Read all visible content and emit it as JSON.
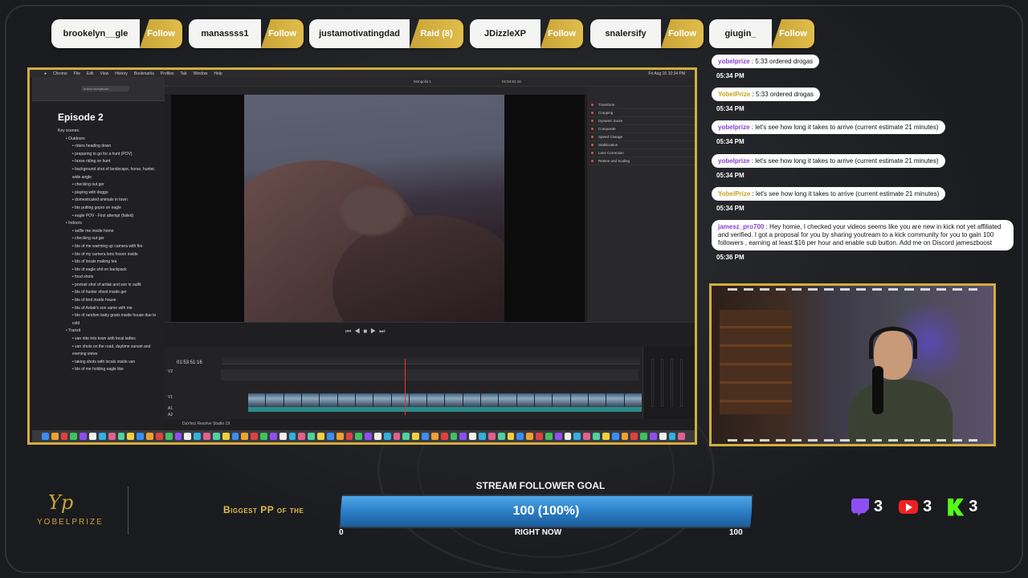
{
  "followers": [
    {
      "name": "brookelyn__gle",
      "action": "Follow"
    },
    {
      "name": "manassss1",
      "action": "Follow"
    },
    {
      "name": "justamotivatingdad",
      "action": "Raid (8)"
    },
    {
      "name": "JDizzleXP",
      "action": "Follow"
    },
    {
      "name": "snalersify",
      "action": "Follow"
    },
    {
      "name": "giugin_",
      "action": "Follow"
    }
  ],
  "editor": {
    "doc_title": "Episode 2",
    "doc_items": [
      {
        "t": "Key scenes:",
        "lvl": 0
      },
      {
        "t": "Outdoors",
        "lvl": 1
      },
      {
        "t": "riders heading down",
        "lvl": 2
      },
      {
        "t": "preparing to go for a hunt (POV)",
        "lvl": 2
      },
      {
        "t": "horse riding on hunt",
        "lvl": 2
      },
      {
        "t": "background shot of landscape, horse, hunter, wide angle",
        "lvl": 2
      },
      {
        "t": "checking out ger",
        "lvl": 2
      },
      {
        "t": "playing with doggo",
        "lvl": 2
      },
      {
        "t": "domesticated animals in town",
        "lvl": 2
      },
      {
        "t": "bts putting gopro on eagle",
        "lvl": 2
      },
      {
        "t": "eagle POV - First attempt (failed)",
        "lvl": 2
      },
      {
        "t": "Indoors",
        "lvl": 1
      },
      {
        "t": "selfie me inside home",
        "lvl": 2
      },
      {
        "t": "checking out ger",
        "lvl": 2
      },
      {
        "t": "bts of me warming up camera with fire",
        "lvl": 2
      },
      {
        "t": "bts of my camera lens frozen inside",
        "lvl": 2
      },
      {
        "t": "bts of locals making tea",
        "lvl": 2
      },
      {
        "t": "bts of eagle shit on backpack",
        "lvl": 2
      },
      {
        "t": "food shots",
        "lvl": 2
      },
      {
        "t": "portrait shot of ardak and son in outfit",
        "lvl": 2
      },
      {
        "t": "bts of hunter shoot inside ger",
        "lvl": 2
      },
      {
        "t": "bts of bird inside house",
        "lvl": 2
      },
      {
        "t": "bts of Ardak's son same with me",
        "lvl": 2
      },
      {
        "t": "bts of random baby goats inside house due to cold",
        "lvl": 2
      },
      {
        "t": "Transit",
        "lvl": 1
      },
      {
        "t": "van ride into town with local ladies",
        "lvl": 2
      },
      {
        "t": "van shots on the road, daytime sunset and evening views",
        "lvl": 2
      },
      {
        "t": "taking shots with locals inside van",
        "lvl": 2
      },
      {
        "t": "bts of me holding eagle like",
        "lvl": 2
      }
    ],
    "url": "notion.so/episode",
    "project": "Mongolia 1",
    "timecode": "01:53:51:16",
    "viewer_tc": "01:53:51:16",
    "app_name": "DaVinci Resolve Studio 19",
    "inspector_rows": [
      "Transform",
      "Cropping",
      "Dynamic Zoom",
      "Composite",
      "Speed Change",
      "Stabilization",
      "Lens Correction",
      "Retime and Scaling"
    ],
    "track_labels": [
      "V2",
      "V1",
      "A1",
      "A2"
    ],
    "menu": [
      "Chrome",
      "File",
      "Edit",
      "View",
      "History",
      "Bookmarks",
      "Profiles",
      "Tab",
      "Window",
      "Help"
    ],
    "date": "Fri Aug 16 10:34 PM",
    "accent_color": "#d3ad3e"
  },
  "chat": [
    {
      "user": "yobelprize",
      "text": "5:33 ordered drogas",
      "time": "05:34 PM",
      "user_color": "purple"
    },
    {
      "user": "YobelPrize",
      "text": "5:33 ordered drogas",
      "time": "05:34 PM",
      "user_color": "gold"
    },
    {
      "user": "yobelprize",
      "text": "let's see how long it takes to arrive (current estimate 21 minutes)",
      "time": "05:34 PM",
      "user_color": "purple"
    },
    {
      "user": "yobelprize",
      "text": "let's see how long it takes to arrive (current estimate 21 minutes)",
      "time": "05:34 PM",
      "user_color": "purple"
    },
    {
      "user": "YobelPrize",
      "text": "let's see how long it takes to arrive (current estimate 21 minutes)",
      "time": "05:34 PM",
      "user_color": "gold"
    },
    {
      "user": "jamesz_pro700",
      "text": "Hey homie, I checked your videos seems like you are new in kick not yet affiliated and verified. I got a proposal for you by sharing youtream to a kick community for you to gain 100 followers , earning at least $16 per hour and enable sub button. Add me on Discord jameszboost",
      "time": "05:36 PM",
      "user_color": "purple"
    }
  ],
  "brand": {
    "name": "YOBELPRIZE",
    "mark": "Yp"
  },
  "ticker": "Biggest PP of the",
  "goal": {
    "title": "STREAM FOLLOWER GOAL",
    "value_text": "100 (100%)",
    "progress": 1.0,
    "min": "0",
    "label": "RIGHT NOW",
    "max": "100"
  },
  "platform_counts": [
    {
      "platform": "twitch-icon",
      "count": "3",
      "color": "#8e4ff2"
    },
    {
      "platform": "youtube-icon",
      "count": "3",
      "color": "#e22222"
    },
    {
      "platform": "kick-icon",
      "count": "3",
      "color": "#53fc18"
    }
  ]
}
